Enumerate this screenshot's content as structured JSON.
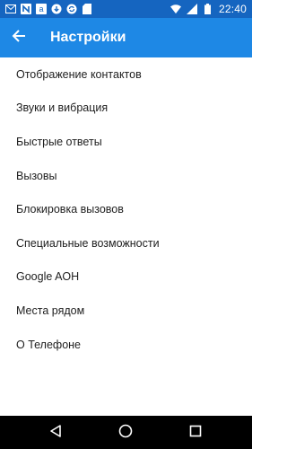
{
  "status_bar": {
    "time": "22:40",
    "left_icons": [
      "gmail-icon",
      "n-app-icon",
      "amazon-icon",
      "download-icon",
      "sync-icon",
      "sd-card-icon"
    ],
    "right_icons": [
      "wifi-icon",
      "signal-icon",
      "battery-icon"
    ]
  },
  "app_bar": {
    "title": "Настройки",
    "back_icon": "arrow-back-icon"
  },
  "settings": {
    "items": [
      {
        "label": "Отображение контактов"
      },
      {
        "label": "Звуки и вибрация"
      },
      {
        "label": "Быстрые ответы"
      },
      {
        "label": "Вызовы"
      },
      {
        "label": "Блокировка вызовов"
      },
      {
        "label": "Специальные возможности"
      },
      {
        "label": "Google AOH"
      },
      {
        "label": "Места рядом"
      },
      {
        "label": "О Телефоне"
      }
    ]
  },
  "nav_bar": {
    "icons": [
      "back-triangle-icon",
      "home-circle-icon",
      "recents-square-icon"
    ]
  },
  "colors": {
    "status_bar": "#1565c0",
    "app_bar": "#1e88e5",
    "text": "#212121",
    "nav_bar": "#000000"
  }
}
